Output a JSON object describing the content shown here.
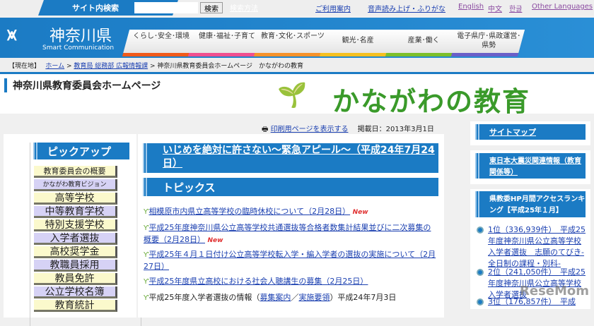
{
  "topbar": {
    "search_label": "サイト内検索",
    "search_value": "",
    "search_button": "検索",
    "search_help": "検索方法",
    "guide": "ご利用案内",
    "speech": "音声読み上げ・ふりがな",
    "languages": [
      "English",
      "中文",
      "한글",
      "Other Languages"
    ]
  },
  "header": {
    "logo_name": "神奈川県",
    "logo_sub": "Smart Communication",
    "nav": [
      {
        "label": "くらし･安全･環境",
        "color": "#f05a1a"
      },
      {
        "label": "健康･福祉･子育て",
        "color": "#ef4f8f"
      },
      {
        "label": "教育･文化･スポーツ",
        "color": "#f5922a"
      },
      {
        "label": "観光･名産",
        "color": "#f5c020"
      },
      {
        "label": "産業･働く",
        "color": "#7cbf2a"
      },
      {
        "label": "電子県庁･県政運営･県勢",
        "color": "#6a5fc8"
      }
    ]
  },
  "breadcrumb": {
    "prefix": "【現在地】",
    "items": [
      "ホーム",
      "教育局 総務部 広報情報課"
    ],
    "current": "神奈川県教育委員会ホームページ　かながわの教育"
  },
  "page": {
    "title": "神奈川県教育委員会ホームページ",
    "banner": "かながわの教育",
    "print": "印刷用ページを表示する",
    "date": "掲載日：2013年3月1日"
  },
  "pickup": {
    "title": "ピックアップ",
    "items": [
      "教育委員会の概要",
      "かながわ教育ビジョン",
      "高等学校",
      "中等教育学校",
      "特別支援学校",
      "入学者選抜",
      "高校奨学金",
      "教職員採用",
      "教員免許",
      "公立学校名簿",
      "教育統計"
    ]
  },
  "main": {
    "appeal": "いじめを絶対に許さない～緊急アピール～（平成24年7月24日）",
    "topics_title": "トピックス",
    "new_label": "New",
    "topics": [
      "相模原市内県立高等学校の臨時休校について（2月28日）",
      "平成25年度神奈川県公立高等学校共通選抜等合格者数集計結果並びに二次募集の概要（2月28日）",
      "平成25年４月１日付け公立高等学校転入学・編入学者の選抜の実施について（2月27日）",
      "平成25年度県立高校における社会人聴講生の募集（2月25日）"
    ],
    "last_topic": {
      "prefix": "平成25年度入学者選抜の情報（",
      "link1": "募集案内",
      "sep": "／",
      "link2": "実施要領",
      "suffix": "）平成24年7月3日"
    }
  },
  "right": {
    "sitemap": "サイトマップ",
    "quake": "東日本大震災関連情報（教育関係等）",
    "ranking_title": "県教委HP月間アクセスランキング【平成25年１月】",
    "ranking": [
      "1位（336,939件）　平成25年度神奈川県公立高等学校入学者選抜　志願のてびき-全日制の課程・別科-",
      "2位（241,050件）　平成25年度神奈川県公立高等学校入学者選抜",
      "3位（176,857件）　平成"
    ]
  },
  "watermark": "ReseMom"
}
